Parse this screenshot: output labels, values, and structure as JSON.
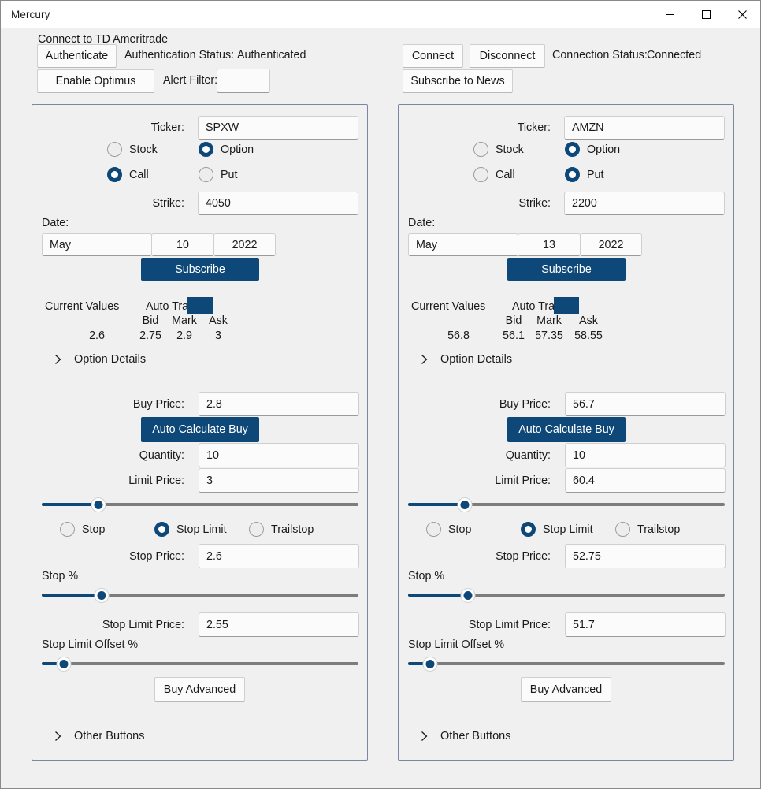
{
  "window": {
    "title": "Mercury",
    "controls": {
      "minimize": "minimize-icon",
      "maximize": "maximize-icon",
      "close": "close-icon"
    }
  },
  "topbar": {
    "section_title": "Connect to TD Ameritrade",
    "authenticate_button": "Authenticate",
    "auth_status_label": "Authentication Status:",
    "auth_status_value": "Authenticated",
    "enable_optimus_button": "Enable Optimus",
    "alert_filter_label": "Alert Filter:",
    "alert_filter_value": "",
    "connect_button": "Connect",
    "disconnect_button": "Disconnect",
    "connection_status_label": "Connection Status:",
    "connection_status_value": "Connected",
    "subscribe_news_button": "Subscribe to News"
  },
  "shared": {
    "ticker_label": "Ticker:",
    "stock_label": "Stock",
    "option_label": "Option",
    "call_label": "Call",
    "put_label": "Put",
    "strike_label": "Strike:",
    "date_label": "Date:",
    "subscribe_button": "Subscribe",
    "current_values_label": "Current Values",
    "auto_track_label": "Auto Track",
    "bid_label": "Bid",
    "mark_label": "Mark",
    "ask_label": "Ask",
    "option_details_label": "Option Details",
    "buy_price_label": "Buy Price:",
    "auto_calculate_buy_button": "Auto Calculate Buy",
    "quantity_label": "Quantity:",
    "limit_price_label": "Limit Price:",
    "stop_label": "Stop",
    "stop_limit_label": "Stop Limit",
    "trailstop_label": "Trailstop",
    "stop_price_label": "Stop Price:",
    "stop_percent_label": "Stop %",
    "stop_limit_price_label": "Stop Limit Price:",
    "stop_limit_offset_label": "Stop Limit Offset %",
    "buy_advanced_button": "Buy Advanced",
    "other_buttons_label": "Other Buttons"
  },
  "panels": [
    {
      "id": "left",
      "ticker": "SPXW",
      "instrument_type": "Option",
      "option_side": "Call",
      "strike": "4050",
      "date_month": "May",
      "date_day": "10",
      "date_year": "2022",
      "auto_track_checked": true,
      "current_value": "2.6",
      "bid": "2.75",
      "mark": "2.9",
      "ask": "3",
      "buy_price": "2.8",
      "quantity": "10",
      "limit_price": "3",
      "limit_slider_percent": 18,
      "order_type": "Stop Limit",
      "stop_price": "2.6",
      "stop_percent_slider": 19,
      "stop_limit_price": "2.55",
      "stop_limit_offset_slider": 7
    },
    {
      "id": "right",
      "ticker": "AMZN",
      "instrument_type": "Option",
      "option_side": "Put",
      "strike": "2200",
      "date_month": "May",
      "date_day": "13",
      "date_year": "2022",
      "auto_track_checked": true,
      "current_value": "56.8",
      "bid": "56.1",
      "mark": "57.35",
      "ask": "58.55",
      "buy_price": "56.7",
      "quantity": "10",
      "limit_price": "60.4",
      "limit_slider_percent": 18,
      "order_type": "Stop Limit",
      "stop_price": "52.75",
      "stop_percent_slider": 19,
      "stop_limit_price": "51.7",
      "stop_limit_offset_slider": 7
    }
  ],
  "colors": {
    "accent": "#0d4878",
    "panel_border": "#7b87a0",
    "app_background": "#f0f0f0",
    "field_background": "#fbfbfb",
    "slider_track": "#7c7c7c"
  }
}
